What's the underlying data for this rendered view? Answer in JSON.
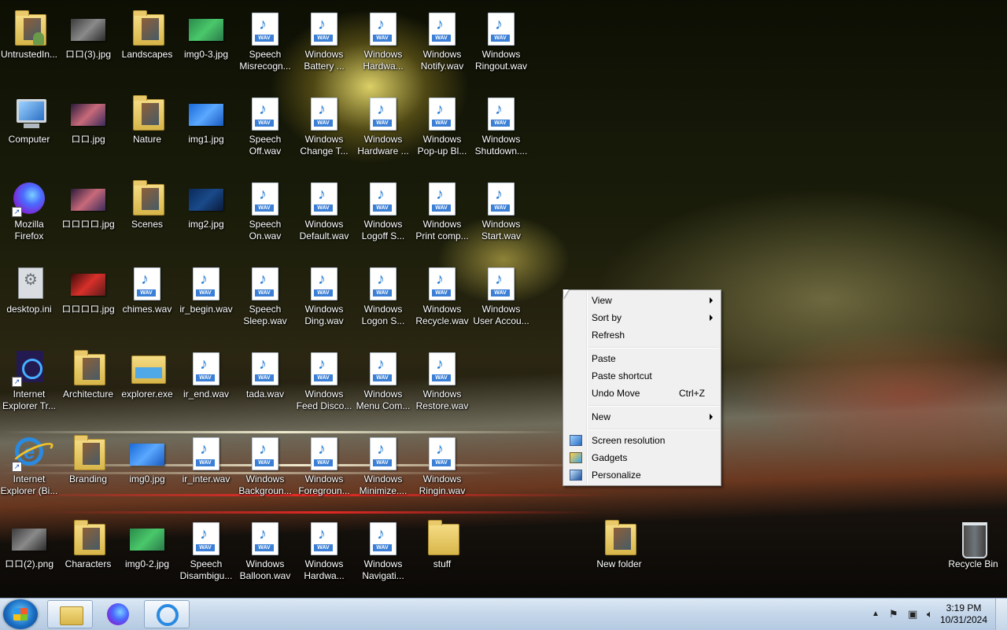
{
  "desktop": {
    "icons": [
      {
        "label": "UntrustedIn...",
        "kind": "folder-user"
      },
      {
        "label": "ロロ(3).jpg",
        "kind": "image-dark"
      },
      {
        "label": "Landscapes",
        "kind": "folder"
      },
      {
        "label": "img0-3.jpg",
        "kind": "image-green"
      },
      {
        "label": "Speech\nMisrecogn...",
        "kind": "wav"
      },
      {
        "label": "Windows\nBattery ...",
        "kind": "wav"
      },
      {
        "label": "Windows\nHardwa...",
        "kind": "wav"
      },
      {
        "label": "Windows\nNotify.wav",
        "kind": "wav"
      },
      {
        "label": "Windows\nRingout.wav",
        "kind": "wav"
      },
      {
        "label": "Computer",
        "kind": "computer"
      },
      {
        "label": "ロロ.jpg",
        "kind": "image-anime"
      },
      {
        "label": "Nature",
        "kind": "folder"
      },
      {
        "label": "img1.jpg",
        "kind": "image-blue"
      },
      {
        "label": "Speech\nOff.wav",
        "kind": "wav"
      },
      {
        "label": "Windows\nChange T...",
        "kind": "wav"
      },
      {
        "label": "Windows\nHardware ...",
        "kind": "wav"
      },
      {
        "label": "Windows\nPop-up Bl...",
        "kind": "wav"
      },
      {
        "label": "Windows\nShutdown....",
        "kind": "wav"
      },
      {
        "label": "Mozilla\nFirefox",
        "kind": "firefox"
      },
      {
        "label": "ロロロロ.jpg",
        "kind": "image-anime"
      },
      {
        "label": "Scenes",
        "kind": "folder"
      },
      {
        "label": "img2.jpg",
        "kind": "image-navy"
      },
      {
        "label": "Speech\nOn.wav",
        "kind": "wav"
      },
      {
        "label": "Windows\nDefault.wav",
        "kind": "wav"
      },
      {
        "label": "Windows\nLogoff S...",
        "kind": "wav"
      },
      {
        "label": "Windows\nPrint comp...",
        "kind": "wav"
      },
      {
        "label": "Windows\nStart.wav",
        "kind": "wav"
      },
      {
        "label": "desktop.ini",
        "kind": "settings"
      },
      {
        "label": "ロロロロ.jpg",
        "kind": "image-red"
      },
      {
        "label": "chimes.wav",
        "kind": "wav"
      },
      {
        "label": "ir_begin.wav",
        "kind": "wav"
      },
      {
        "label": "Speech\nSleep.wav",
        "kind": "wav"
      },
      {
        "label": "Windows\nDing.wav",
        "kind": "wav"
      },
      {
        "label": "Windows\nLogon S...",
        "kind": "wav"
      },
      {
        "label": "Windows\nRecycle.wav",
        "kind": "wav"
      },
      {
        "label": "Windows\nUser Accou...",
        "kind": "wav"
      },
      {
        "label": "Internet\nExplorer Tr...",
        "kind": "ie-dark"
      },
      {
        "label": "Architecture",
        "kind": "folder"
      },
      {
        "label": "explorer.exe",
        "kind": "exe"
      },
      {
        "label": "ir_end.wav",
        "kind": "wav"
      },
      {
        "label": "tada.wav",
        "kind": "wav"
      },
      {
        "label": "Windows\nFeed Disco...",
        "kind": "wav"
      },
      {
        "label": "Windows\nMenu Com...",
        "kind": "wav"
      },
      {
        "label": "Windows\nRestore.wav",
        "kind": "wav"
      },
      {
        "label": "Internet\nExplorer (Bi...",
        "kind": "ie"
      },
      {
        "label": "Branding",
        "kind": "folder"
      },
      {
        "label": "img0.jpg",
        "kind": "image-blue"
      },
      {
        "label": "ir_inter.wav",
        "kind": "wav"
      },
      {
        "label": "Windows\nBackgroun...",
        "kind": "wav"
      },
      {
        "label": "Windows\nForegroun...",
        "kind": "wav"
      },
      {
        "label": "Windows\nMinimize....",
        "kind": "wav"
      },
      {
        "label": "Windows\nRingin.wav",
        "kind": "wav"
      },
      {
        "label": "ロロ(2).png",
        "kind": "image-dark"
      },
      {
        "label": "Characters",
        "kind": "folder"
      },
      {
        "label": "img0-2.jpg",
        "kind": "image-green"
      },
      {
        "label": "Speech\nDisambigu...",
        "kind": "wav"
      },
      {
        "label": "Windows\nBalloon.wav",
        "kind": "wav"
      },
      {
        "label": "Windows\nHardwa...",
        "kind": "wav"
      },
      {
        "label": "Windows\nNavigati...",
        "kind": "wav"
      },
      {
        "label": "stuff",
        "kind": "folder-plain"
      },
      {
        "label": "New folder",
        "kind": "folder"
      },
      {
        "label": "Recycle Bin",
        "kind": "recycle-bin"
      }
    ]
  },
  "context_menu": {
    "view": "View",
    "sort_by": "Sort by",
    "refresh": "Refresh",
    "paste": "Paste",
    "paste_shortcut": "Paste shortcut",
    "undo_move": "Undo Move",
    "undo_move_shortcut": "Ctrl+Z",
    "new": "New",
    "screen_resolution": "Screen resolution",
    "gadgets": "Gadgets",
    "personalize": "Personalize"
  },
  "taskbar": {
    "pinned": [
      {
        "name": "explorer",
        "icon": "folder-icon"
      },
      {
        "name": "firefox",
        "icon": "firefox-icon"
      },
      {
        "name": "internet-explorer",
        "icon": "ie-icon"
      }
    ],
    "clock_time": "3:19 PM",
    "clock_date": "10/31/2024"
  },
  "wav_tag": "WAV"
}
